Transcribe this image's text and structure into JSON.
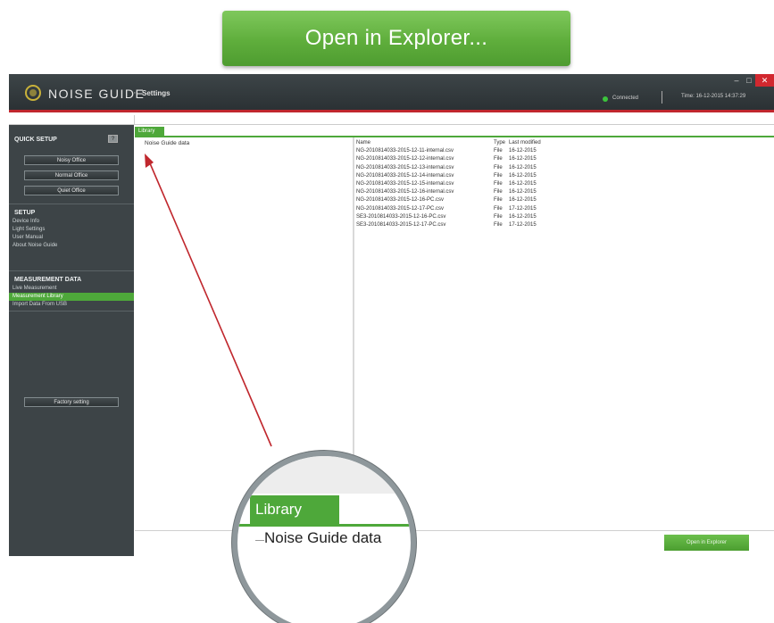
{
  "callout": {
    "button_label": "Open in Explorer..."
  },
  "titlebar": {
    "brand": "NOISE GUIDE",
    "separator": "·",
    "page_name": "Settings",
    "status": "Connected",
    "time": "Time: 16-12-2015 14:37:29",
    "min_glyph": "–",
    "max_glyph": "□",
    "close_glyph": "✕"
  },
  "sidebar": {
    "quick_setup": {
      "heading": "QUICK SETUP",
      "help_glyph": "?",
      "buttons": [
        "Noisy Office",
        "Normal Office",
        "Quiet Office"
      ]
    },
    "setup": {
      "heading": "SETUP",
      "items": [
        "Device Info",
        "Light Settings",
        "User Manual",
        "About Noise Guide"
      ]
    },
    "measurement": {
      "heading": "MEASUREMENT DATA",
      "items": [
        "Live Measurement",
        "Measurement Library",
        "Import Data From USB"
      ],
      "active_index": 1
    },
    "factory_button": "Factory setting"
  },
  "library": {
    "tab_label": "Library",
    "tree_root": "Noise Guide data",
    "columns": {
      "name": "Name",
      "type": "Type",
      "modified": "Last modified"
    },
    "files": [
      {
        "name": "NG-2010814033-2015-12-11-internal.csv",
        "type": "File",
        "modified": "16-12-2015"
      },
      {
        "name": "NG-2010814033-2015-12-12-internal.csv",
        "type": "File",
        "modified": "16-12-2015"
      },
      {
        "name": "NG-2010814033-2015-12-13-internal.csv",
        "type": "File",
        "modified": "16-12-2015"
      },
      {
        "name": "NG-2010814033-2015-12-14-internal.csv",
        "type": "File",
        "modified": "16-12-2015"
      },
      {
        "name": "NG-2010814033-2015-12-15-internal.csv",
        "type": "File",
        "modified": "16-12-2015"
      },
      {
        "name": "NG-2010814033-2015-12-16-internal.csv",
        "type": "File",
        "modified": "16-12-2015"
      },
      {
        "name": "NG-2010814033-2015-12-16-PC.csv",
        "type": "File",
        "modified": "16-12-2015"
      },
      {
        "name": "NG-2010814033-2015-12-17-PC.csv",
        "type": "File",
        "modified": "17-12-2015"
      },
      {
        "name": "SE3-2010814033-2015-12-16-PC.csv",
        "type": "File",
        "modified": "16-12-2015"
      },
      {
        "name": "SE3-2010814033-2015-12-17-PC.csv",
        "type": "File",
        "modified": "17-12-2015"
      }
    ],
    "open_button": "Open in Explorer"
  },
  "magnifier": {
    "tab_label": "Library",
    "tree_text": "Noise Guide data"
  },
  "colors": {
    "accent_green": "#4ea83a",
    "title_red": "#c0272d",
    "sidebar": "#3d4447"
  }
}
